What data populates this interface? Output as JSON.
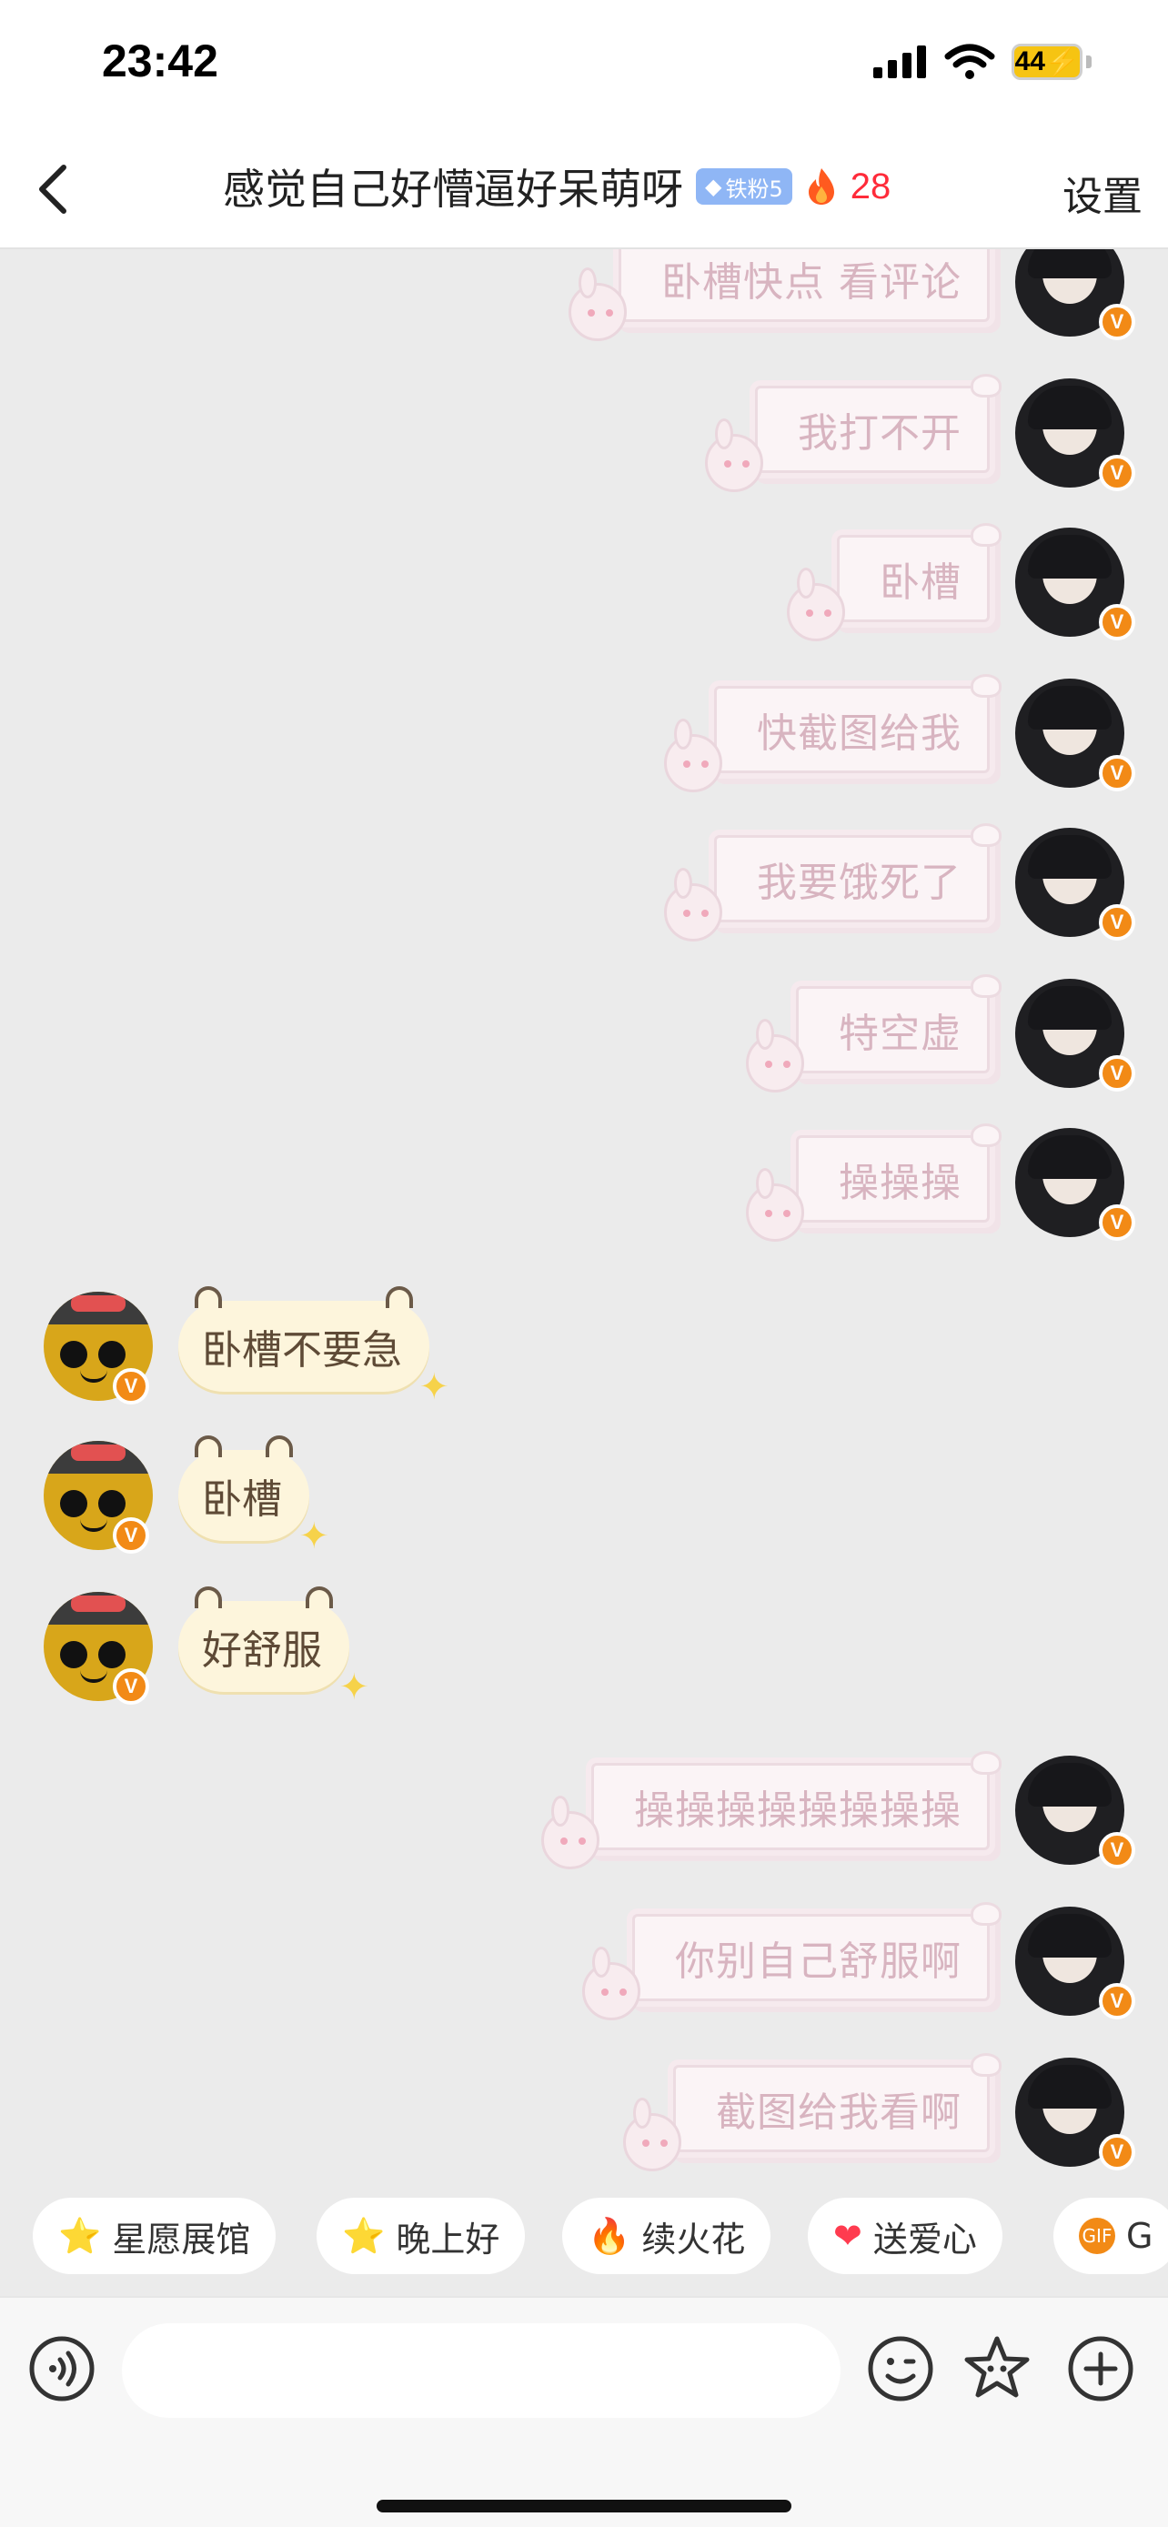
{
  "status_bar": {
    "time": "23:42",
    "battery": "44"
  },
  "header": {
    "title": "感觉自己好懵逼好呆萌呀",
    "fan_badge": "铁粉5",
    "streak": "28",
    "settings_label": "设置"
  },
  "messages": [
    {
      "from": "me",
      "text": "卧槽快点 看评论"
    },
    {
      "from": "me",
      "text": "我打不开"
    },
    {
      "from": "me",
      "text": "卧槽"
    },
    {
      "from": "me",
      "text": "快截图给我"
    },
    {
      "from": "me",
      "text": "我要饿死了"
    },
    {
      "from": "me",
      "text": "特空虚"
    },
    {
      "from": "me",
      "text": "操操操"
    },
    {
      "from": "friend",
      "text": "卧槽不要急"
    },
    {
      "from": "friend",
      "text": "卧槽"
    },
    {
      "from": "friend",
      "text": "好舒服"
    },
    {
      "from": "me",
      "text": "操操操操操操操操"
    },
    {
      "from": "me",
      "text": "你别自己舒服啊"
    },
    {
      "from": "me",
      "text": "截图给我看啊"
    }
  ],
  "quick_replies": [
    {
      "icon": "star-icon",
      "glyph": "⭐",
      "label": "星愿展馆"
    },
    {
      "icon": "star-face-icon",
      "glyph": "⭐",
      "label": "晚上好"
    },
    {
      "icon": "fire-icon",
      "glyph": "🔥",
      "label": "续火花"
    },
    {
      "icon": "heart-icon",
      "glyph": "❤",
      "label": "送爱心"
    },
    {
      "icon": "gif-icon",
      "glyph": "GIF",
      "label": "G"
    }
  ],
  "input": {
    "placeholder": ""
  },
  "colors": {
    "background": "#ebebeb",
    "accent_orange": "#f28a16",
    "streak_red": "#ff2b3a",
    "fan_badge_blue": "#8fb6f5"
  }
}
